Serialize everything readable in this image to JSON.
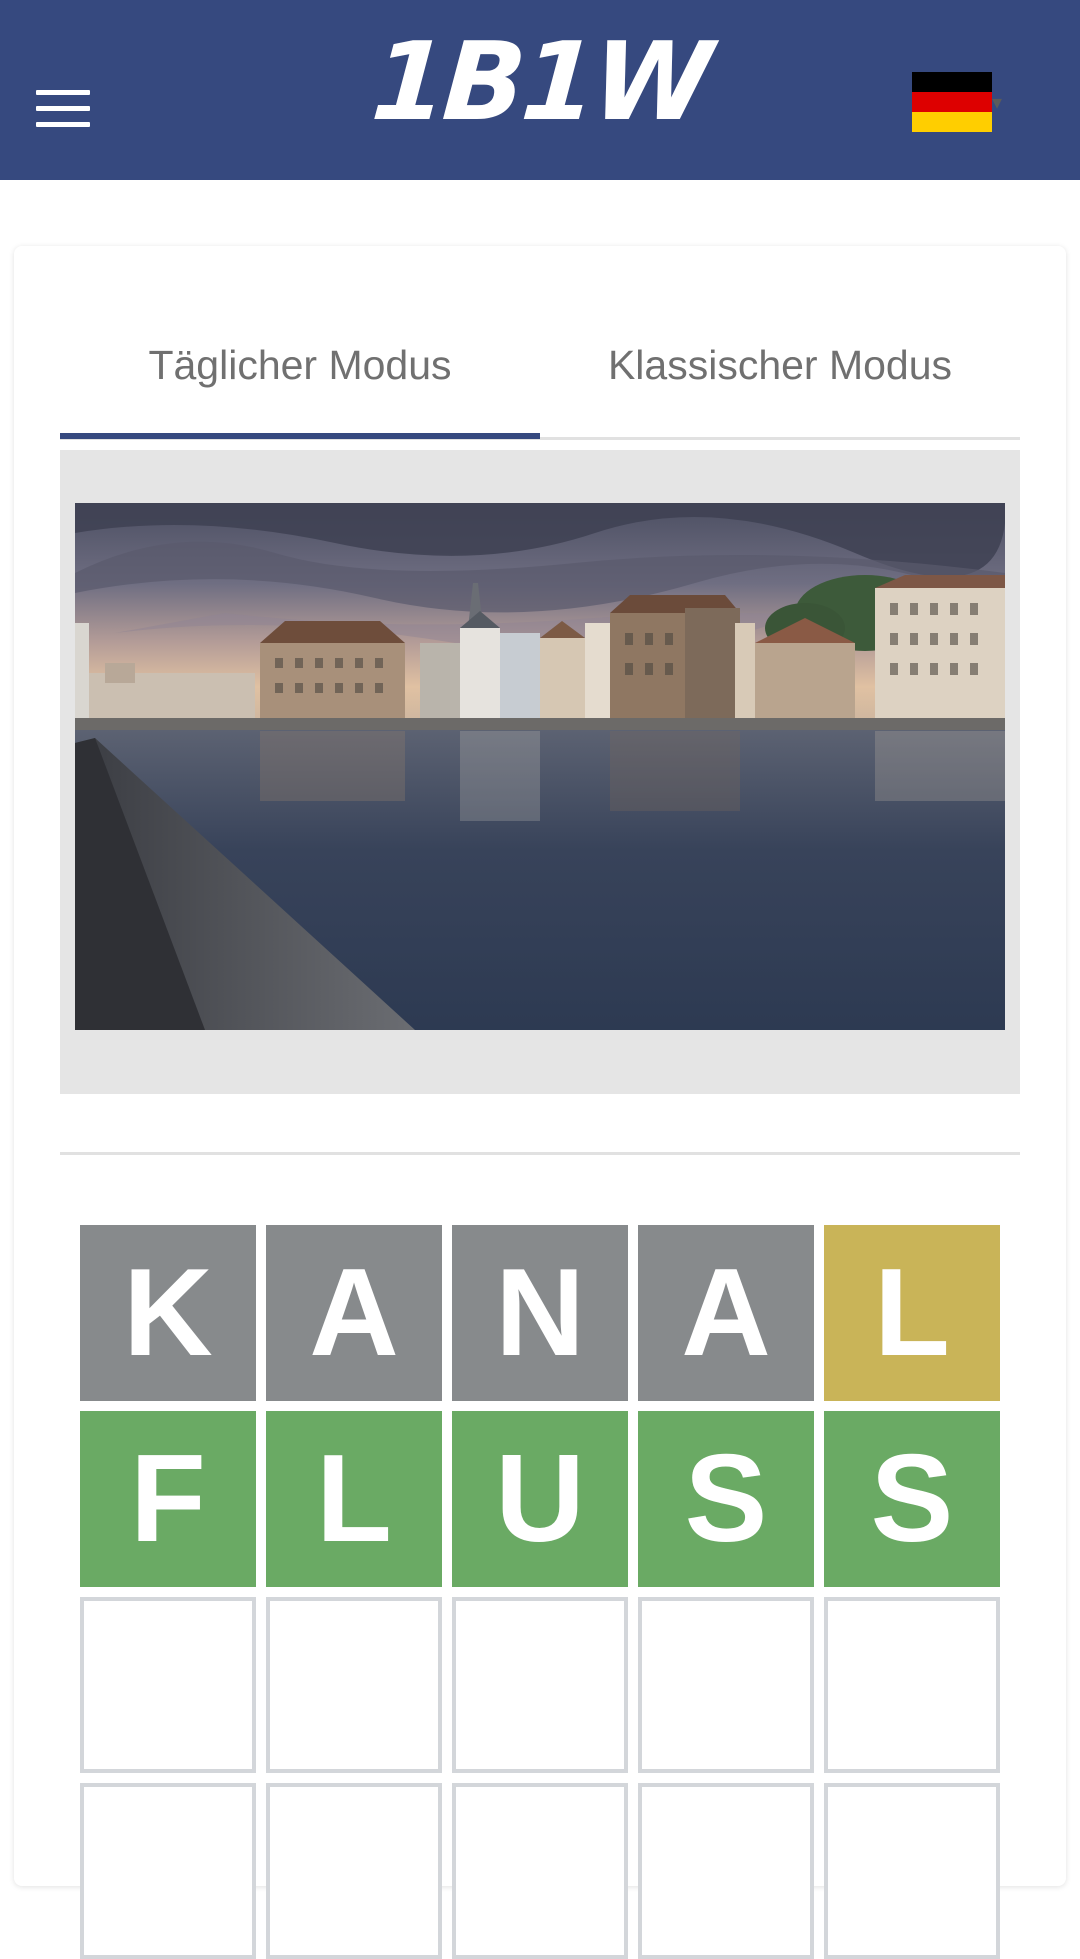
{
  "header": {
    "logo": "1B1W",
    "menu_icon": "hamburger-menu-icon",
    "language_flag": "german-flag-icon",
    "flag_colors": [
      "#000000",
      "#dd0000",
      "#ffce00"
    ],
    "background_color": "#36497f",
    "caret": "▾"
  },
  "tabs": [
    {
      "label": "Täglicher Modus",
      "active": true
    },
    {
      "label": "Klassischer Modus",
      "active": false
    }
  ],
  "hint_image": {
    "description": "river-cityscape-photo"
  },
  "board": {
    "colors": {
      "absent": "#878a8c",
      "present": "#c9b458",
      "correct": "#6aaa64",
      "empty_border": "#d3d6da"
    },
    "rows": [
      [
        {
          "letter": "K",
          "state": "absent"
        },
        {
          "letter": "A",
          "state": "absent"
        },
        {
          "letter": "N",
          "state": "absent"
        },
        {
          "letter": "A",
          "state": "absent"
        },
        {
          "letter": "L",
          "state": "present"
        }
      ],
      [
        {
          "letter": "F",
          "state": "correct"
        },
        {
          "letter": "L",
          "state": "correct"
        },
        {
          "letter": "U",
          "state": "correct"
        },
        {
          "letter": "S",
          "state": "correct"
        },
        {
          "letter": "S",
          "state": "correct"
        }
      ],
      [
        {
          "letter": "",
          "state": "empty"
        },
        {
          "letter": "",
          "state": "empty"
        },
        {
          "letter": "",
          "state": "empty"
        },
        {
          "letter": "",
          "state": "empty"
        },
        {
          "letter": "",
          "state": "empty"
        }
      ],
      [
        {
          "letter": "",
          "state": "empty"
        },
        {
          "letter": "",
          "state": "empty"
        },
        {
          "letter": "",
          "state": "empty"
        },
        {
          "letter": "",
          "state": "empty"
        },
        {
          "letter": "",
          "state": "empty"
        }
      ]
    ]
  }
}
